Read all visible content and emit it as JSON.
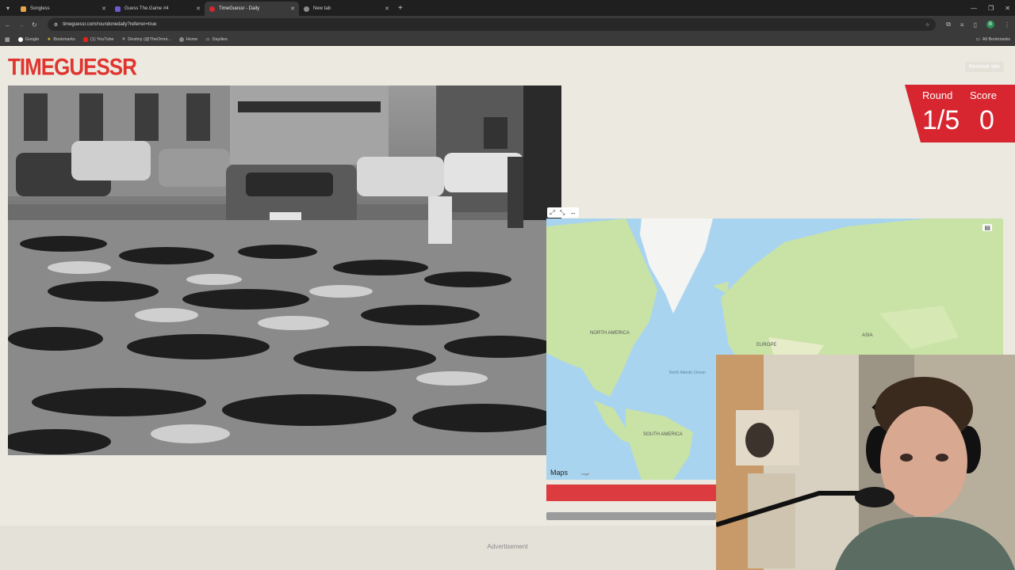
{
  "browser": {
    "tabs": [
      {
        "title": "Songless",
        "color": "#e8a54a",
        "active": false
      },
      {
        "title": "Guess The.Game #4",
        "color": "#6a5acd",
        "active": false
      },
      {
        "title": "TimeGuessr - Daily",
        "color": "#d7262f",
        "active": true
      },
      {
        "title": "New tab",
        "color": "#8a8a8a",
        "active": false
      }
    ],
    "url": "timeguessr.com/roundonedaily?referrer=true",
    "bookmarks": [
      "Google",
      "Bookmarks",
      "(1) YouTube",
      "Destiny (@TheOmni...",
      "Home",
      "Dayilies"
    ],
    "all_bookmarks": "All Bookmarks",
    "profile_initial": "B"
  },
  "page": {
    "logo": "TIMEGUESSR",
    "remove_ads": "Remove ads",
    "round_label": "Round",
    "round_value": "1/5",
    "score_label": "Score",
    "score_value": "0",
    "map": {
      "labels": [
        "NORTH AMERICA",
        "EUROPE",
        "ASIA",
        "North Atlantic Ocean",
        "SOUTH AMERICA"
      ],
      "attribution": "Maps",
      "legal": "Legal"
    },
    "advertisement": "Advertisement"
  },
  "colors": {
    "brand": "#e0352f",
    "score_bg": "#d7262f",
    "page_bg": "#ebe9e0",
    "water": "#a9d4ef",
    "land": "#c6e2a3"
  }
}
